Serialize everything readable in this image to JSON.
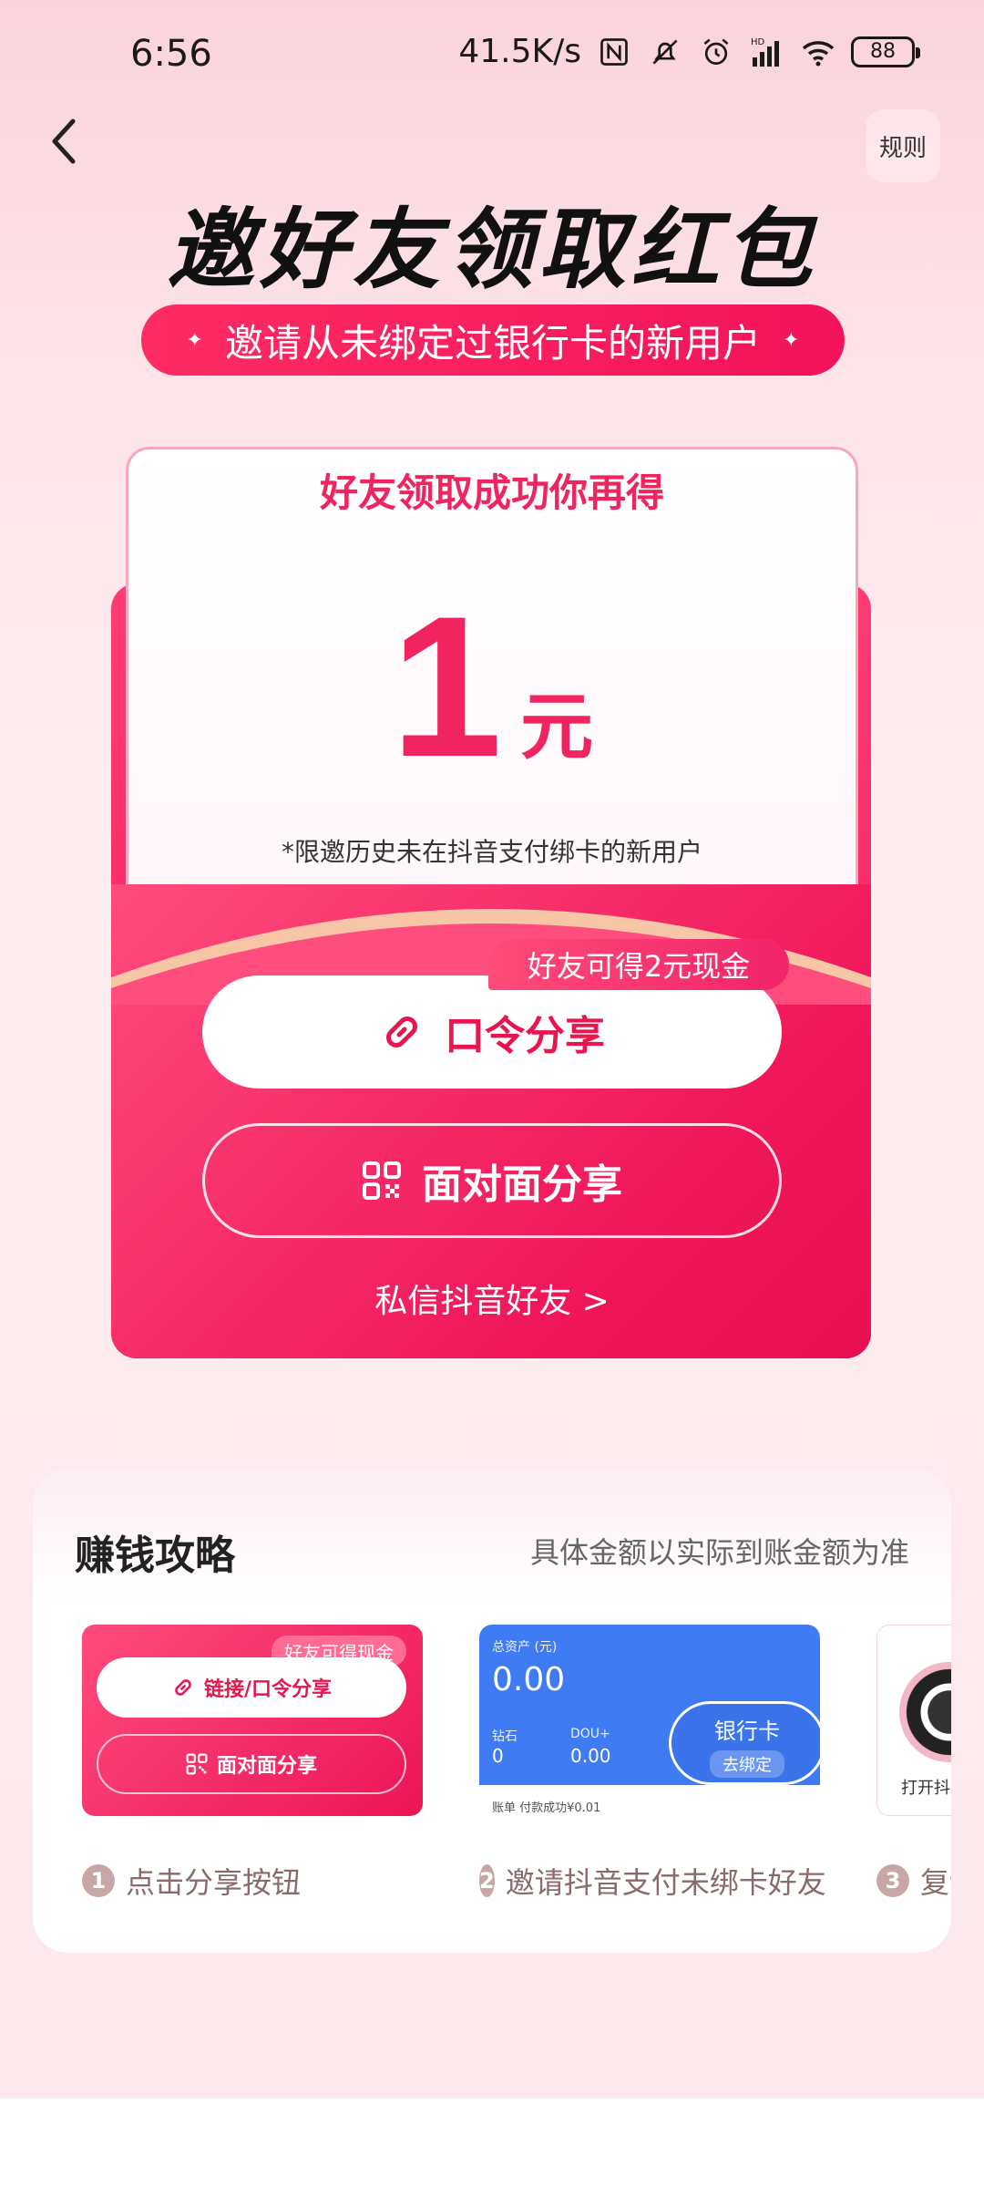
{
  "status_bar": {
    "time": "6:56",
    "net_speed": "41.5K/s",
    "battery": "88",
    "icons": [
      "nfc-icon",
      "mute-icon",
      "alarm-icon",
      "signal-icon",
      "wifi-icon",
      "battery-icon"
    ],
    "hd_label": "HD"
  },
  "nav": {
    "back_icon": "chevron-left-icon",
    "rules_label": "规则"
  },
  "header": {
    "title": "邀好友领取红包",
    "subtitle": "邀请从未绑定过银行卡的新用户",
    "sparkle": "✦"
  },
  "reward_card": {
    "header": "好友领取成功你再得",
    "amount": "1",
    "unit": "元",
    "note": "*限邀历史未在抖音支付绑卡的新用户",
    "bonus_badge": "好友可得2元现金",
    "password_share_label": "口令分享",
    "face_share_label": "面对面分享",
    "private_message_link": "私信抖音好友 >"
  },
  "strategy": {
    "title": "赚钱攻略",
    "note": "具体金额以实际到账金额为准",
    "steps": [
      {
        "num": "1",
        "label": "点击分享按钮",
        "mini_badge": "好友可得现金",
        "mini_btn1": "链接/口令分享",
        "mini_btn2": "面对面分享"
      },
      {
        "num": "2",
        "label": "邀请抖音支付未绑卡好友",
        "wallet_label": "总资产 (元)",
        "wallet_value": "0.00",
        "sub1_label": "钻石",
        "sub1_value": "0",
        "sub2_label": "DOU+",
        "sub2_value": "0.00",
        "bubble_title": "银行卡",
        "bubble_btn": "去绑定",
        "footer": "账单  付款成功¥0.01"
      },
      {
        "num": "3",
        "label": "复制",
        "mini_text": "打开抖"
      }
    ]
  },
  "colors": {
    "accent": "#f0245f",
    "card_red": "#ef175a",
    "bank_blue": "#3f7bf2"
  }
}
